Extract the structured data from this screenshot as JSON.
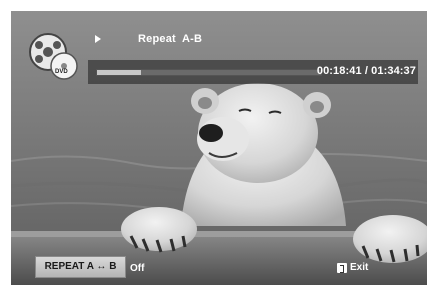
{
  "osd": {
    "mode_title": "Repeat  A-B",
    "time_display": "00:18:41 / 01:34:37",
    "progress_fraction": 0.198,
    "disc_label": "DVD"
  },
  "footer": {
    "repeat_button_label": "REPEAT A ↔ B",
    "repeat_status": "Off",
    "exit_label": "Exit"
  },
  "icons": {
    "play": "play-icon",
    "disc": "dvd-disc-icon",
    "exit": "exit-icon"
  }
}
